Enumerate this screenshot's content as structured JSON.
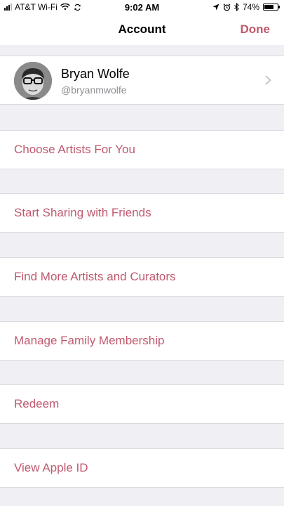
{
  "status_bar": {
    "carrier": "AT&T Wi-Fi",
    "time": "9:02 AM",
    "battery": "74%",
    "battery_level": 0.74
  },
  "nav": {
    "title": "Account",
    "done_label": "Done"
  },
  "profile": {
    "name": "Bryan Wolfe",
    "handle": "@bryanmwolfe"
  },
  "actions": [
    {
      "label": "Choose Artists For You"
    },
    {
      "label": "Start Sharing with Friends"
    },
    {
      "label": "Find More Artists and Curators"
    },
    {
      "label": "Manage Family Membership"
    },
    {
      "label": "Redeem"
    },
    {
      "label": "View Apple ID"
    }
  ],
  "colors": {
    "accent": "#bf5a6e",
    "background": "#efeff4",
    "secondary_text": "#8e8e93"
  }
}
